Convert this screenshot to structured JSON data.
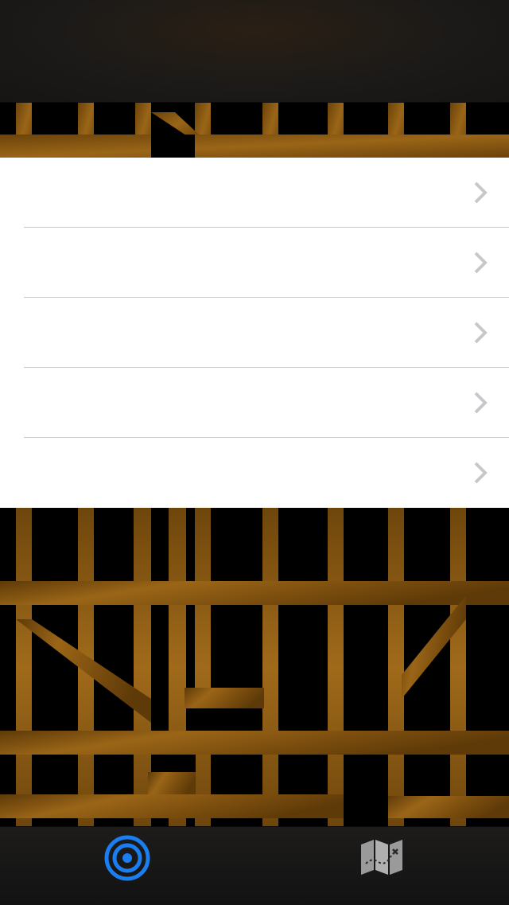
{
  "navbar": {
    "title": ""
  },
  "list": {
    "rows": [
      {
        "label": ""
      },
      {
        "label": ""
      },
      {
        "label": ""
      },
      {
        "label": ""
      },
      {
        "label": ""
      }
    ]
  },
  "tabbar": {
    "tabs": [
      {
        "icon": "target-icon",
        "selected": true,
        "color": "#1a7df0"
      },
      {
        "icon": "treasure-map-icon",
        "selected": false,
        "color": "#9a9a9a"
      }
    ]
  },
  "colors": {
    "wood": "#8a5a12",
    "wood_dark": "#5e3a08",
    "background": "#000000",
    "separator": "#c8c7cc",
    "chevron": "#c7c7cc"
  }
}
